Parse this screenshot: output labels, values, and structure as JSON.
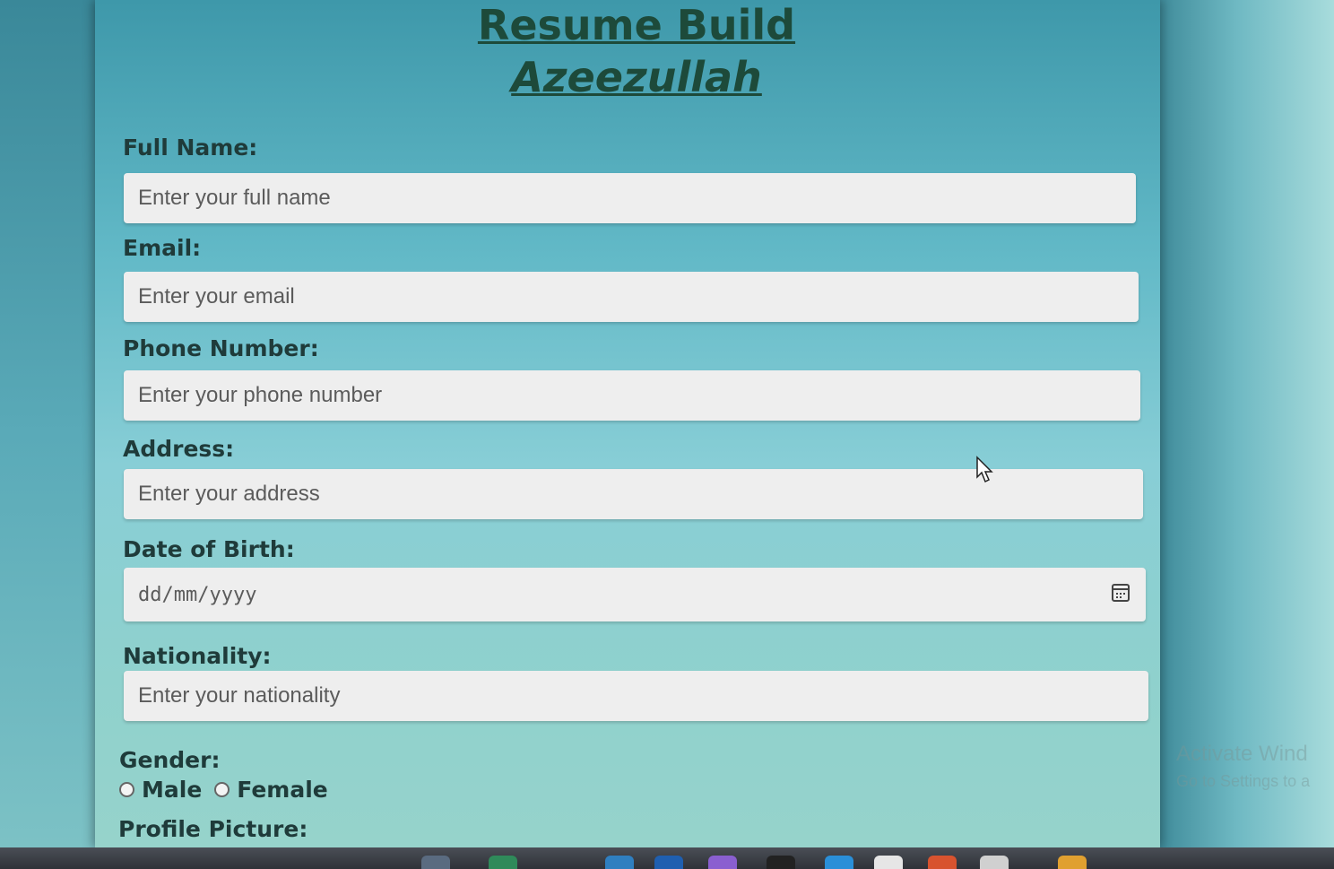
{
  "header": {
    "title": "Resume Build",
    "subtitle": "Azeezullah"
  },
  "form": {
    "full_name": {
      "label": "Full Name:",
      "placeholder": "Enter your full name"
    },
    "email": {
      "label": "Email:",
      "placeholder": "Enter your email"
    },
    "phone": {
      "label": "Phone Number:",
      "placeholder": "Enter your phone number"
    },
    "address": {
      "label": "Address:",
      "placeholder": "Enter your address"
    },
    "dob": {
      "label": "Date of Birth:",
      "placeholder": "dd/mm/yyyy",
      "icon": "calendar-icon"
    },
    "nationality": {
      "label": "Nationality:",
      "placeholder": "Enter your nationality"
    },
    "gender": {
      "label": "Gender:",
      "options": [
        "Male",
        "Female"
      ]
    },
    "profile_picture": {
      "label": "Profile Picture:"
    }
  },
  "watermark": {
    "line1": "Activate Wind",
    "line2": "Go to Settings to a"
  },
  "colors": {
    "heading": "#1d4a3a",
    "label": "#1f3b3a",
    "field_bg": "#eeeeee",
    "page_bg": "#62b9c7"
  }
}
